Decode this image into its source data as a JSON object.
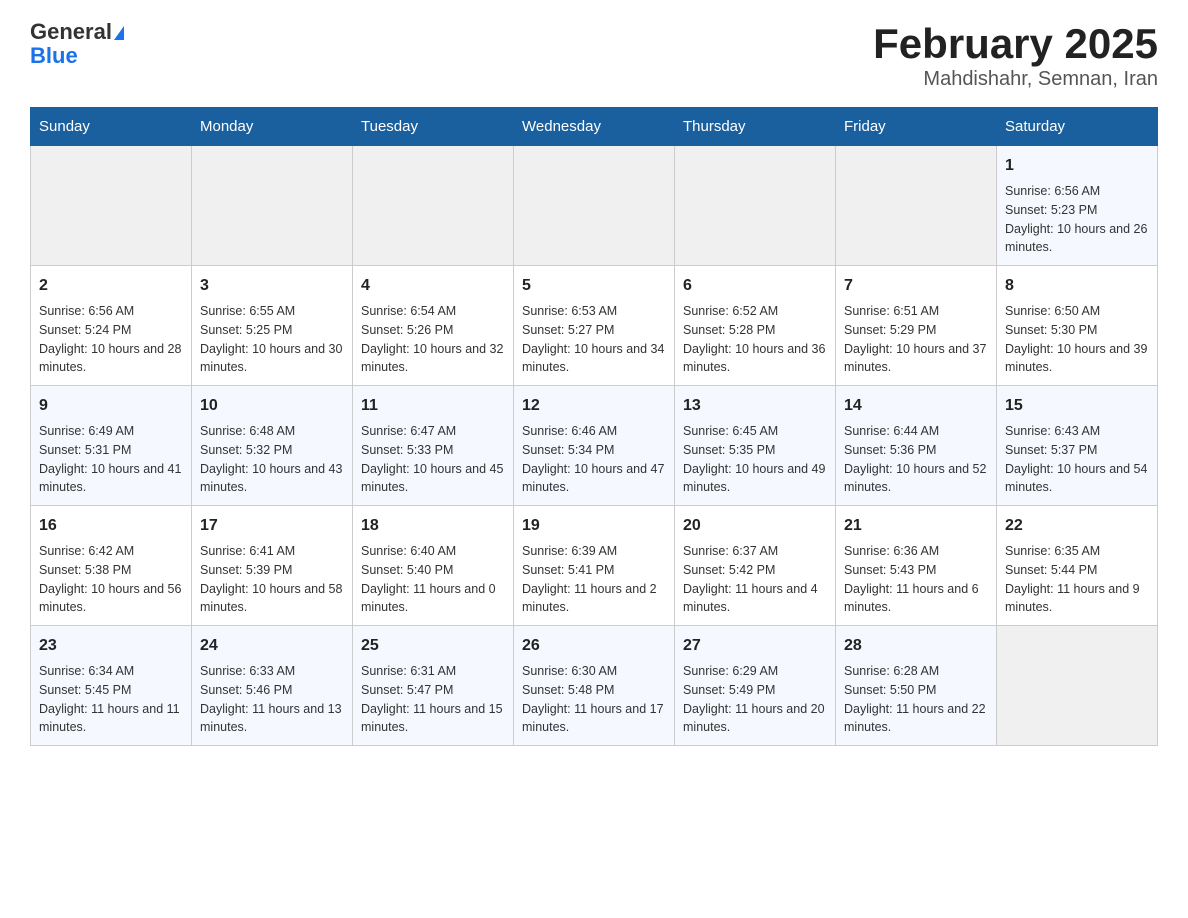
{
  "header": {
    "logo_general": "General",
    "logo_blue": "Blue",
    "title": "February 2025",
    "subtitle": "Mahdishahr, Semnan, Iran"
  },
  "weekdays": [
    "Sunday",
    "Monday",
    "Tuesday",
    "Wednesday",
    "Thursday",
    "Friday",
    "Saturday"
  ],
  "weeks": [
    [
      {
        "day": "",
        "info": ""
      },
      {
        "day": "",
        "info": ""
      },
      {
        "day": "",
        "info": ""
      },
      {
        "day": "",
        "info": ""
      },
      {
        "day": "",
        "info": ""
      },
      {
        "day": "",
        "info": ""
      },
      {
        "day": "1",
        "info": "Sunrise: 6:56 AM\nSunset: 5:23 PM\nDaylight: 10 hours and 26 minutes."
      }
    ],
    [
      {
        "day": "2",
        "info": "Sunrise: 6:56 AM\nSunset: 5:24 PM\nDaylight: 10 hours and 28 minutes."
      },
      {
        "day": "3",
        "info": "Sunrise: 6:55 AM\nSunset: 5:25 PM\nDaylight: 10 hours and 30 minutes."
      },
      {
        "day": "4",
        "info": "Sunrise: 6:54 AM\nSunset: 5:26 PM\nDaylight: 10 hours and 32 minutes."
      },
      {
        "day": "5",
        "info": "Sunrise: 6:53 AM\nSunset: 5:27 PM\nDaylight: 10 hours and 34 minutes."
      },
      {
        "day": "6",
        "info": "Sunrise: 6:52 AM\nSunset: 5:28 PM\nDaylight: 10 hours and 36 minutes."
      },
      {
        "day": "7",
        "info": "Sunrise: 6:51 AM\nSunset: 5:29 PM\nDaylight: 10 hours and 37 minutes."
      },
      {
        "day": "8",
        "info": "Sunrise: 6:50 AM\nSunset: 5:30 PM\nDaylight: 10 hours and 39 minutes."
      }
    ],
    [
      {
        "day": "9",
        "info": "Sunrise: 6:49 AM\nSunset: 5:31 PM\nDaylight: 10 hours and 41 minutes."
      },
      {
        "day": "10",
        "info": "Sunrise: 6:48 AM\nSunset: 5:32 PM\nDaylight: 10 hours and 43 minutes."
      },
      {
        "day": "11",
        "info": "Sunrise: 6:47 AM\nSunset: 5:33 PM\nDaylight: 10 hours and 45 minutes."
      },
      {
        "day": "12",
        "info": "Sunrise: 6:46 AM\nSunset: 5:34 PM\nDaylight: 10 hours and 47 minutes."
      },
      {
        "day": "13",
        "info": "Sunrise: 6:45 AM\nSunset: 5:35 PM\nDaylight: 10 hours and 49 minutes."
      },
      {
        "day": "14",
        "info": "Sunrise: 6:44 AM\nSunset: 5:36 PM\nDaylight: 10 hours and 52 minutes."
      },
      {
        "day": "15",
        "info": "Sunrise: 6:43 AM\nSunset: 5:37 PM\nDaylight: 10 hours and 54 minutes."
      }
    ],
    [
      {
        "day": "16",
        "info": "Sunrise: 6:42 AM\nSunset: 5:38 PM\nDaylight: 10 hours and 56 minutes."
      },
      {
        "day": "17",
        "info": "Sunrise: 6:41 AM\nSunset: 5:39 PM\nDaylight: 10 hours and 58 minutes."
      },
      {
        "day": "18",
        "info": "Sunrise: 6:40 AM\nSunset: 5:40 PM\nDaylight: 11 hours and 0 minutes."
      },
      {
        "day": "19",
        "info": "Sunrise: 6:39 AM\nSunset: 5:41 PM\nDaylight: 11 hours and 2 minutes."
      },
      {
        "day": "20",
        "info": "Sunrise: 6:37 AM\nSunset: 5:42 PM\nDaylight: 11 hours and 4 minutes."
      },
      {
        "day": "21",
        "info": "Sunrise: 6:36 AM\nSunset: 5:43 PM\nDaylight: 11 hours and 6 minutes."
      },
      {
        "day": "22",
        "info": "Sunrise: 6:35 AM\nSunset: 5:44 PM\nDaylight: 11 hours and 9 minutes."
      }
    ],
    [
      {
        "day": "23",
        "info": "Sunrise: 6:34 AM\nSunset: 5:45 PM\nDaylight: 11 hours and 11 minutes."
      },
      {
        "day": "24",
        "info": "Sunrise: 6:33 AM\nSunset: 5:46 PM\nDaylight: 11 hours and 13 minutes."
      },
      {
        "day": "25",
        "info": "Sunrise: 6:31 AM\nSunset: 5:47 PM\nDaylight: 11 hours and 15 minutes."
      },
      {
        "day": "26",
        "info": "Sunrise: 6:30 AM\nSunset: 5:48 PM\nDaylight: 11 hours and 17 minutes."
      },
      {
        "day": "27",
        "info": "Sunrise: 6:29 AM\nSunset: 5:49 PM\nDaylight: 11 hours and 20 minutes."
      },
      {
        "day": "28",
        "info": "Sunrise: 6:28 AM\nSunset: 5:50 PM\nDaylight: 11 hours and 22 minutes."
      },
      {
        "day": "",
        "info": ""
      }
    ]
  ]
}
